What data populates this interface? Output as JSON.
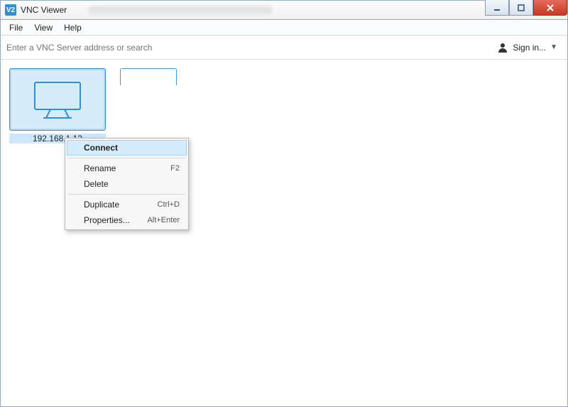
{
  "window": {
    "title": "VNC Viewer",
    "app_icon_text": "V2"
  },
  "menubar": {
    "items": [
      "File",
      "View",
      "Help"
    ]
  },
  "search": {
    "placeholder": "Enter a VNC Server address or search"
  },
  "signin": {
    "label": "Sign in..."
  },
  "connections": [
    {
      "label": "192.168.1.13",
      "selected": true
    }
  ],
  "context_menu": {
    "items": [
      {
        "label": "Connect",
        "bold": true,
        "selected": true
      },
      {
        "separator": true
      },
      {
        "label": "Rename",
        "shortcut": "F2"
      },
      {
        "label": "Delete"
      },
      {
        "separator": true
      },
      {
        "label": "Duplicate",
        "shortcut": "Ctrl+D"
      },
      {
        "label": "Properties...",
        "shortcut": "Alt+Enter"
      }
    ]
  }
}
